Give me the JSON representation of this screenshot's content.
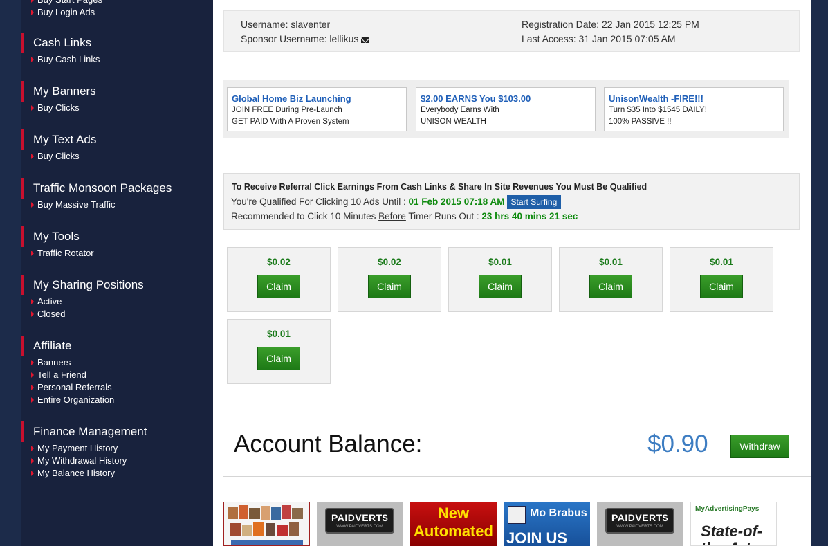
{
  "sidebar": {
    "top_items": [
      "Buy Start Pages",
      "Buy Login Ads"
    ],
    "groups": [
      {
        "title": "Cash Links",
        "items": [
          "Buy Cash Links"
        ]
      },
      {
        "title": "My Banners",
        "items": [
          "Buy Clicks"
        ]
      },
      {
        "title": "My Text Ads",
        "items": [
          "Buy Clicks"
        ]
      },
      {
        "title": "Traffic Monsoon Packages",
        "items": [
          "Buy Massive Traffic"
        ]
      },
      {
        "title": "My Tools",
        "items": [
          "Traffic Rotator"
        ]
      },
      {
        "title": "My Sharing Positions",
        "items": [
          "Active",
          "Closed"
        ]
      },
      {
        "title": "Affiliate",
        "items": [
          "Banners",
          "Tell a Friend",
          "Personal Referrals",
          "Entire Organization"
        ]
      },
      {
        "title": "Finance Management",
        "items": [
          "My Payment History",
          "My Withdrawal History",
          "My Balance History"
        ]
      }
    ]
  },
  "account": {
    "username": "Username: slaventer",
    "sponsor": "Sponsor Username: lellikus",
    "registration": "Registration Date: 22 Jan 2015 12:25 PM",
    "last_access": "Last Access: 31 Jan 2015 07:05 AM"
  },
  "text_ads": [
    {
      "headline": "Global Home Biz Launching",
      "line1": "JOIN FREE During Pre-Launch",
      "line2": "GET PAID With A Proven System"
    },
    {
      "headline": "$2.00 EARNS You $103.00",
      "line1": "Everybody Earns With",
      "line2": "UNISON WEALTH"
    },
    {
      "headline": "UnisonWealth -FIRE!!!",
      "line1": "Turn $35 Into $1545 DAILY!",
      "line2": "100% PASSIVE !!"
    }
  ],
  "qualification": {
    "heading": "To Receive Referral Click Earnings From Cash Links & Share In Site Revenues You Must Be Qualified",
    "line2_prefix": "You're Qualified For Clicking 10 Ads Until : ",
    "until": "01 Feb 2015 07:18 AM",
    "surf_button": "Start Surfing",
    "line3_prefix": "Recommended to Click 10 Minutes ",
    "line3_before": "Before",
    "line3_mid": " Timer Runs Out : ",
    "timer": "23 hrs 40 mins 21 sec"
  },
  "claims": [
    {
      "amount": "$0.02",
      "label": "Claim"
    },
    {
      "amount": "$0.02",
      "label": "Claim"
    },
    {
      "amount": "$0.01",
      "label": "Claim"
    },
    {
      "amount": "$0.01",
      "label": "Claim"
    },
    {
      "amount": "$0.01",
      "label": "Claim"
    },
    {
      "amount": "$0.01",
      "label": "Claim"
    }
  ],
  "balance": {
    "label": "Account Balance:",
    "value": "$0.90",
    "withdraw": "Withdraw"
  },
  "banners": {
    "paidverts_title": "PAIDVERT$",
    "paidverts_url": "WWW.PAIDVERTS.COM",
    "automated_l1": "New",
    "automated_l2": "Automated",
    "mobrabus_title": "Mo Brabus",
    "mobrabus_join": "JOIN US",
    "map_title": "MyAdvertisingPays",
    "map_slogan": "State-of-the-Art"
  }
}
